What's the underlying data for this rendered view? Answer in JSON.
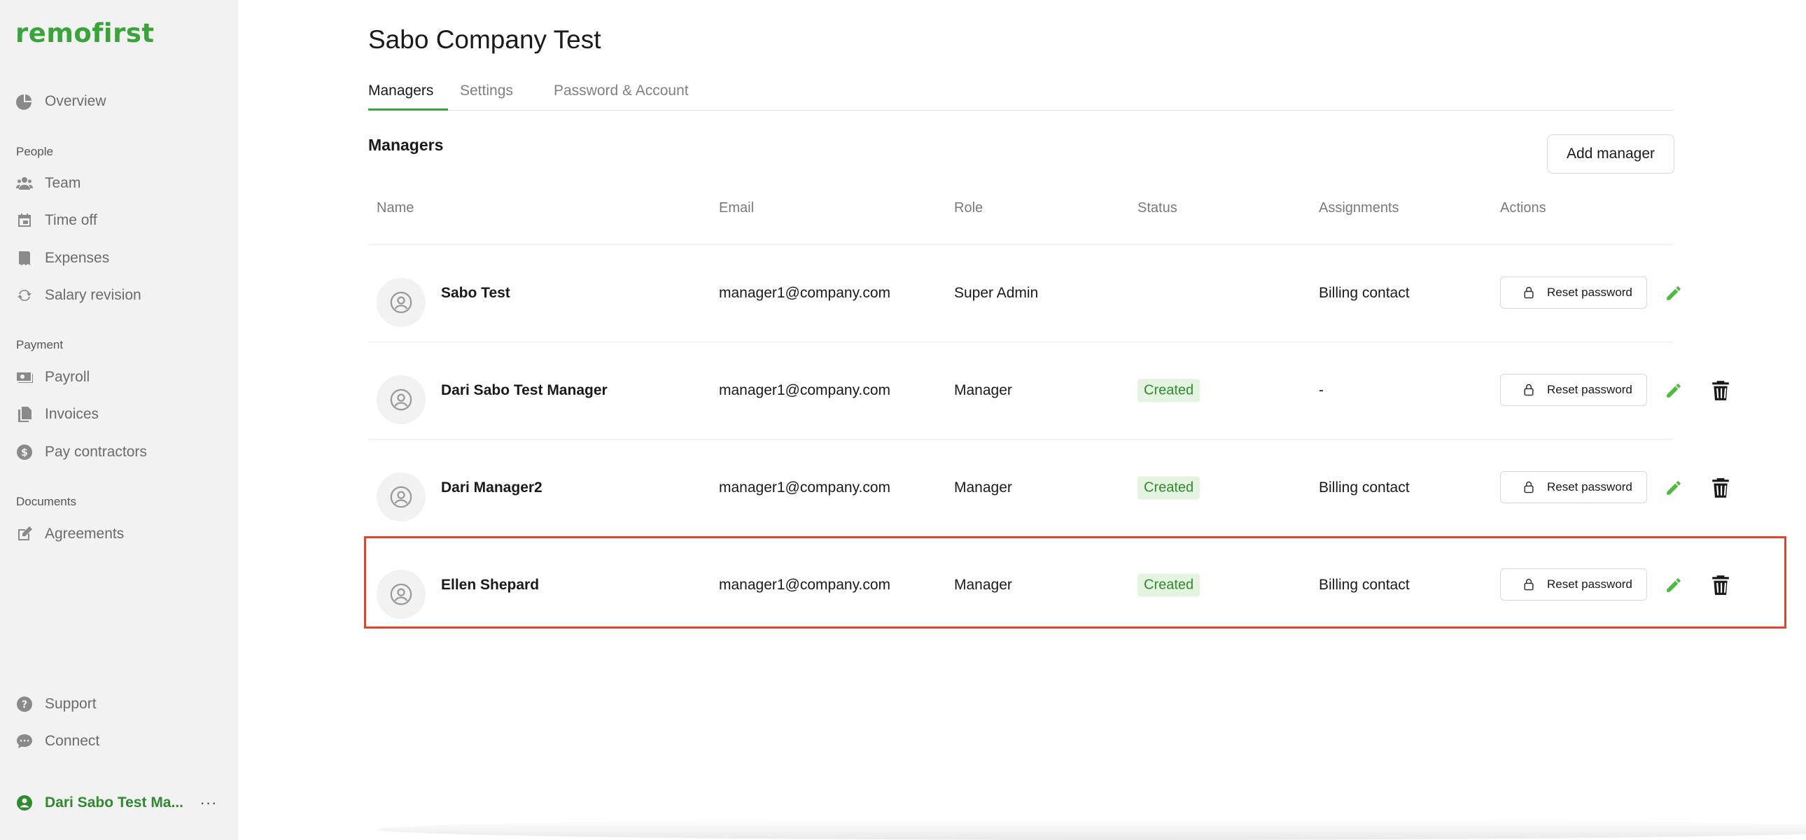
{
  "brand": {
    "logo_text": "remofirst",
    "accent_color": "#3aa43a"
  },
  "sidebar": {
    "overview": {
      "label": "Overview",
      "icon": "pie-chart-icon"
    },
    "sections": [
      {
        "label": "People",
        "items": [
          {
            "label": "Team",
            "icon": "team-icon"
          },
          {
            "label": "Time off",
            "icon": "calendar-icon"
          },
          {
            "label": "Expenses",
            "icon": "receipt-icon"
          },
          {
            "label": "Salary revision",
            "icon": "refresh-icon"
          }
        ]
      },
      {
        "label": "Payment",
        "items": [
          {
            "label": "Payroll",
            "icon": "money-icon"
          },
          {
            "label": "Invoices",
            "icon": "documents-icon"
          },
          {
            "label": "Pay contractors",
            "icon": "dollar-icon"
          }
        ]
      },
      {
        "label": "Documents",
        "items": [
          {
            "label": "Agreements",
            "icon": "edit-document-icon"
          }
        ]
      }
    ],
    "support": {
      "label": "Support",
      "icon": "help-icon"
    },
    "connect": {
      "label": "Connect",
      "icon": "chat-icon"
    },
    "user": {
      "label": "Dari Sabo Test Ma...",
      "icon": "user-circle-icon",
      "more": "···"
    }
  },
  "page": {
    "title": "Sabo Company Test",
    "tabs": [
      {
        "label": "Managers",
        "active": true
      },
      {
        "label": "Settings",
        "active": false
      },
      {
        "label": "Password & Account",
        "active": false
      }
    ],
    "section_title": "Managers",
    "add_button": "Add manager"
  },
  "table": {
    "columns": [
      "Name",
      "Email",
      "Role",
      "Status",
      "Assignments",
      "Actions"
    ],
    "reset_label": "Reset password",
    "rows": [
      {
        "name": "Sabo Test",
        "email": "manager1@company.com",
        "role": "Super Admin",
        "status": "",
        "assignments": "Billing contact",
        "deletable": false
      },
      {
        "name": "Dari Sabo Test Manager",
        "email": "manager1@company.com",
        "role": "Manager",
        "status": "Created",
        "assignments": "-",
        "deletable": true
      },
      {
        "name": "Dari Manager2",
        "email": "manager1@company.com",
        "role": "Manager",
        "status": "Created",
        "assignments": "Billing contact",
        "deletable": true
      },
      {
        "name": "Ellen Shepard",
        "email": "manager1@company.com",
        "role": "Manager",
        "status": "Created",
        "assignments": "Billing contact",
        "deletable": true,
        "highlighted": true
      }
    ]
  },
  "colors": {
    "highlight": "#e0442e",
    "badge_bg": "#e4f4e1",
    "badge_text": "#2f8a2f",
    "edit_icon": "#4cbb3f"
  }
}
